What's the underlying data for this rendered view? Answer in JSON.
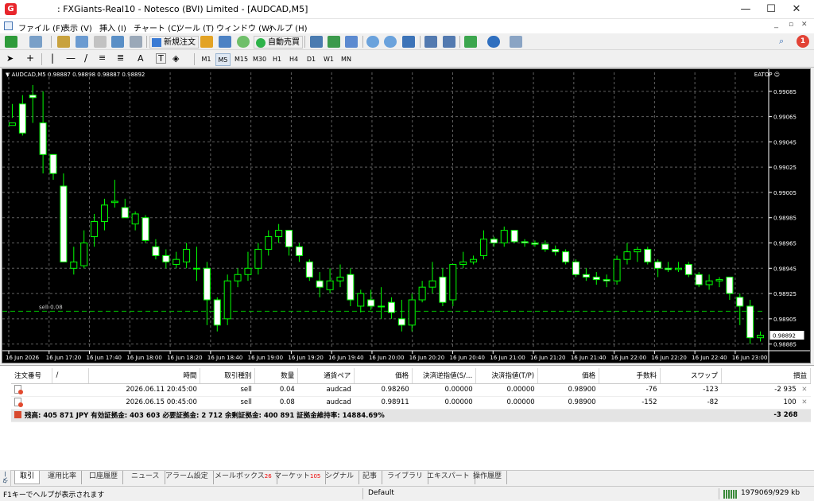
{
  "window": {
    "title": ": FXGiants-Real10 - Notesco (BVI) Limited - [AUDCAD,M5]",
    "app_icon": "G",
    "minimize": "—",
    "maximize": "☐",
    "close": "✕"
  },
  "menu": [
    "ファイル (F)",
    "表示 (V)",
    "挿入 (I)",
    "チャート (C)",
    "ツール (T)",
    "ウィンドウ (W)",
    "ヘルプ (H)"
  ],
  "toolbar": {
    "new_order": "新規注文",
    "auto_trading": "自動売買",
    "notification_count": "1"
  },
  "drawing_tools": {
    "text_tool": "A",
    "text_label_tool": "T"
  },
  "timeframes": [
    "M1",
    "M5",
    "M15",
    "M30",
    "H1",
    "H4",
    "D1",
    "W1",
    "MN"
  ],
  "active_timeframe": "M5",
  "chart": {
    "header": "▼ AUDCAD,M5  0.98887 0.98898 0.98887 0.98892",
    "ea": "EATOP ☺",
    "order_label": "sell 0.08",
    "current_price": "0.98892"
  },
  "chart_data": {
    "type": "candlestick",
    "symbol": "AUDCAD",
    "timeframe": "M5",
    "y_ticks": [
      "0.99085",
      "0.99065",
      "0.99045",
      "0.99025",
      "0.99005",
      "0.98985",
      "0.98965",
      "0.98945",
      "0.98925",
      "0.98905",
      "0.98885"
    ],
    "ylim": [
      0.98881,
      0.991
    ],
    "x_ticks": [
      "16 Jun 2026",
      "16 Jun 17:20",
      "16 Jun 17:40",
      "16 Jun 18:00",
      "16 Jun 18:20",
      "16 Jun 18:40",
      "16 Jun 19:00",
      "16 Jun 19:20",
      "16 Jun 19:40",
      "16 Jun 20:00",
      "16 Jun 20:20",
      "16 Jun 20:40",
      "16 Jun 21:00",
      "16 Jun 21:20",
      "16 Jun 21:40",
      "16 Jun 22:00",
      "16 Jun 22:20",
      "16 Jun 22:40",
      "16 Jun 23:00"
    ],
    "order_line": 0.98911,
    "candles": [
      [
        0.99058,
        0.99075,
        0.99064,
        0.9906
      ],
      [
        0.99075,
        0.99082,
        0.9905,
        0.99052
      ],
      [
        0.99082,
        0.9909,
        0.9906,
        0.9908
      ],
      [
        0.9906,
        0.99085,
        0.9902,
        0.99035
      ],
      [
        0.99035,
        0.99035,
        0.99015,
        0.9902
      ],
      [
        0.9901,
        0.9902,
        0.9895,
        0.9895
      ],
      [
        0.98945,
        0.98962,
        0.9894,
        0.9895
      ],
      [
        0.98947,
        0.98975,
        0.98945,
        0.98965
      ],
      [
        0.9897,
        0.98988,
        0.98962,
        0.98982
      ],
      [
        0.98982,
        0.99,
        0.98975,
        0.98995
      ],
      [
        0.98997,
        0.99015,
        0.98993,
        0.98998
      ],
      [
        0.98993,
        0.99,
        0.98985,
        0.98985
      ],
      [
        0.9898,
        0.9899,
        0.98975,
        0.98988
      ],
      [
        0.98985,
        0.98987,
        0.98965,
        0.98967
      ],
      [
        0.98962,
        0.98968,
        0.98952,
        0.98955
      ],
      [
        0.98955,
        0.9896,
        0.98945,
        0.9895
      ],
      [
        0.98948,
        0.98958,
        0.98945,
        0.98952
      ],
      [
        0.9895,
        0.98965,
        0.98945,
        0.9896
      ],
      [
        0.98945,
        0.98962,
        0.98935,
        0.98945
      ],
      [
        0.98945,
        0.9895,
        0.989,
        0.9892
      ],
      [
        0.9892,
        0.98922,
        0.98895,
        0.989
      ],
      [
        0.98905,
        0.9894,
        0.989,
        0.98935
      ],
      [
        0.98935,
        0.98945,
        0.9893,
        0.9894
      ],
      [
        0.9894,
        0.98958,
        0.98935,
        0.98945
      ],
      [
        0.98945,
        0.98965,
        0.9894,
        0.9896
      ],
      [
        0.9896,
        0.98975,
        0.98955,
        0.9897
      ],
      [
        0.9897,
        0.9898,
        0.98965,
        0.98975
      ],
      [
        0.98975,
        0.98975,
        0.98955,
        0.98962
      ],
      [
        0.98962,
        0.98965,
        0.9895,
        0.98955
      ],
      [
        0.9895,
        0.98952,
        0.98935,
        0.98938
      ],
      [
        0.98935,
        0.98942,
        0.98922,
        0.9893
      ],
      [
        0.98928,
        0.98945,
        0.98925,
        0.98935
      ],
      [
        0.98935,
        0.98948,
        0.9893,
        0.98938
      ],
      [
        0.9894,
        0.98945,
        0.98915,
        0.9892
      ],
      [
        0.98915,
        0.98928,
        0.9891,
        0.98925
      ],
      [
        0.9892,
        0.98928,
        0.98912,
        0.98915
      ],
      [
        0.98915,
        0.9893,
        0.98905,
        0.98915
      ],
      [
        0.98918,
        0.98922,
        0.98905,
        0.9891
      ],
      [
        0.98905,
        0.9892,
        0.98895,
        0.989
      ],
      [
        0.989,
        0.98925,
        0.98895,
        0.9892
      ],
      [
        0.9892,
        0.98935,
        0.98918,
        0.9893
      ],
      [
        0.9893,
        0.9895,
        0.98925,
        0.98935
      ],
      [
        0.98938,
        0.98945,
        0.98915,
        0.98918
      ],
      [
        0.9892,
        0.98945,
        0.98915,
        0.98948
      ],
      [
        0.98948,
        0.98958,
        0.98945,
        0.9895
      ],
      [
        0.9895,
        0.98955,
        0.98948,
        0.98952
      ],
      [
        0.98955,
        0.98975,
        0.98952,
        0.98968
      ],
      [
        0.98968,
        0.9897,
        0.98962,
        0.98965
      ],
      [
        0.98965,
        0.98978,
        0.98962,
        0.98975
      ],
      [
        0.98975,
        0.98975,
        0.98965,
        0.98966
      ],
      [
        0.98966,
        0.98968,
        0.98962,
        0.98965
      ],
      [
        0.98965,
        0.98967,
        0.98962,
        0.98964
      ],
      [
        0.98964,
        0.98967,
        0.98958,
        0.9896
      ],
      [
        0.9896,
        0.98963,
        0.98955,
        0.98958
      ],
      [
        0.98958,
        0.9896,
        0.98948,
        0.9895
      ],
      [
        0.9895,
        0.98952,
        0.98938,
        0.9894
      ],
      [
        0.9894,
        0.98945,
        0.98935,
        0.98938
      ],
      [
        0.98938,
        0.98942,
        0.98932,
        0.98936
      ],
      [
        0.98936,
        0.9894,
        0.9893,
        0.98935
      ],
      [
        0.98935,
        0.98955,
        0.98932,
        0.98952
      ],
      [
        0.98952,
        0.98965,
        0.98948,
        0.98958
      ],
      [
        0.98958,
        0.98962,
        0.9895,
        0.9896
      ],
      [
        0.9896,
        0.98962,
        0.98948,
        0.9895
      ],
      [
        0.9895,
        0.98952,
        0.98938,
        0.98945
      ],
      [
        0.98945,
        0.9895,
        0.98942,
        0.98944
      ],
      [
        0.98944,
        0.9895,
        0.98942,
        0.98945
      ],
      [
        0.98948,
        0.9895,
        0.98938,
        0.9894
      ],
      [
        0.9894,
        0.98942,
        0.9893,
        0.98932
      ],
      [
        0.98932,
        0.9894,
        0.98928,
        0.98935
      ],
      [
        0.98935,
        0.98938,
        0.9893,
        0.98936
      ],
      [
        0.98938,
        0.98938,
        0.9892,
        0.98925
      ],
      [
        0.98922,
        0.98925,
        0.989,
        0.98915
      ],
      [
        0.98915,
        0.9892,
        0.98885,
        0.9889
      ],
      [
        0.9889,
        0.98895,
        0.98887,
        0.98892
      ]
    ]
  },
  "terminal": {
    "side_label": "ターミナル",
    "columns": [
      "注文番号",
      "/",
      "時間",
      "取引種別",
      "数量",
      "通貨ペア",
      "価格",
      "決済逆指値(S/...",
      "決済指値(T/P)",
      "価格",
      "手数料",
      "スワップ",
      "損益"
    ],
    "rows": [
      [
        "",
        "",
        "2026.06.11 20:45:00",
        "sell",
        "0.04",
        "audcad",
        "0.98260",
        "0.00000",
        "0.00000",
        "0.98900",
        "-76",
        "-123",
        "-2 935"
      ],
      [
        "",
        "",
        "2026.06.15 00:45:00",
        "sell",
        "0.08",
        "audcad",
        "0.98911",
        "0.00000",
        "0.00000",
        "0.98900",
        "-152",
        "-82",
        "100"
      ]
    ],
    "summary": "残高: 405 871 JPY  有効証拠金: 403 603  必要証拠金: 2 712  余剰証拠金: 400 891  証拠金維持率: 14884.69%",
    "summary_total": "-3 268",
    "close_glyph": "✕"
  },
  "tabs": [
    {
      "label": "取引",
      "badge": ""
    },
    {
      "label": "運用比率",
      "badge": ""
    },
    {
      "label": "口座履歴",
      "badge": ""
    },
    {
      "label": "ニュース",
      "badge": ""
    },
    {
      "label": "アラーム設定",
      "badge": ""
    },
    {
      "label": "メールボックス",
      "badge": "26"
    },
    {
      "label": "マーケット",
      "badge": "105"
    },
    {
      "label": "シグナル",
      "badge": ""
    },
    {
      "label": "記事",
      "badge": ""
    },
    {
      "label": "ライブラリ",
      "badge": ""
    },
    {
      "label": "エキスパート",
      "badge": ""
    },
    {
      "label": "操作履歴",
      "badge": ""
    }
  ],
  "status": {
    "help": "F1キーでヘルプが表示されます",
    "profile": "Default",
    "traffic": "1979069/929 kb"
  },
  "colors": {
    "bull": "#00ff00",
    "bear": "#ffffff",
    "grid": "#606060",
    "axis": "#ffffff",
    "brand": "#e8262c"
  }
}
